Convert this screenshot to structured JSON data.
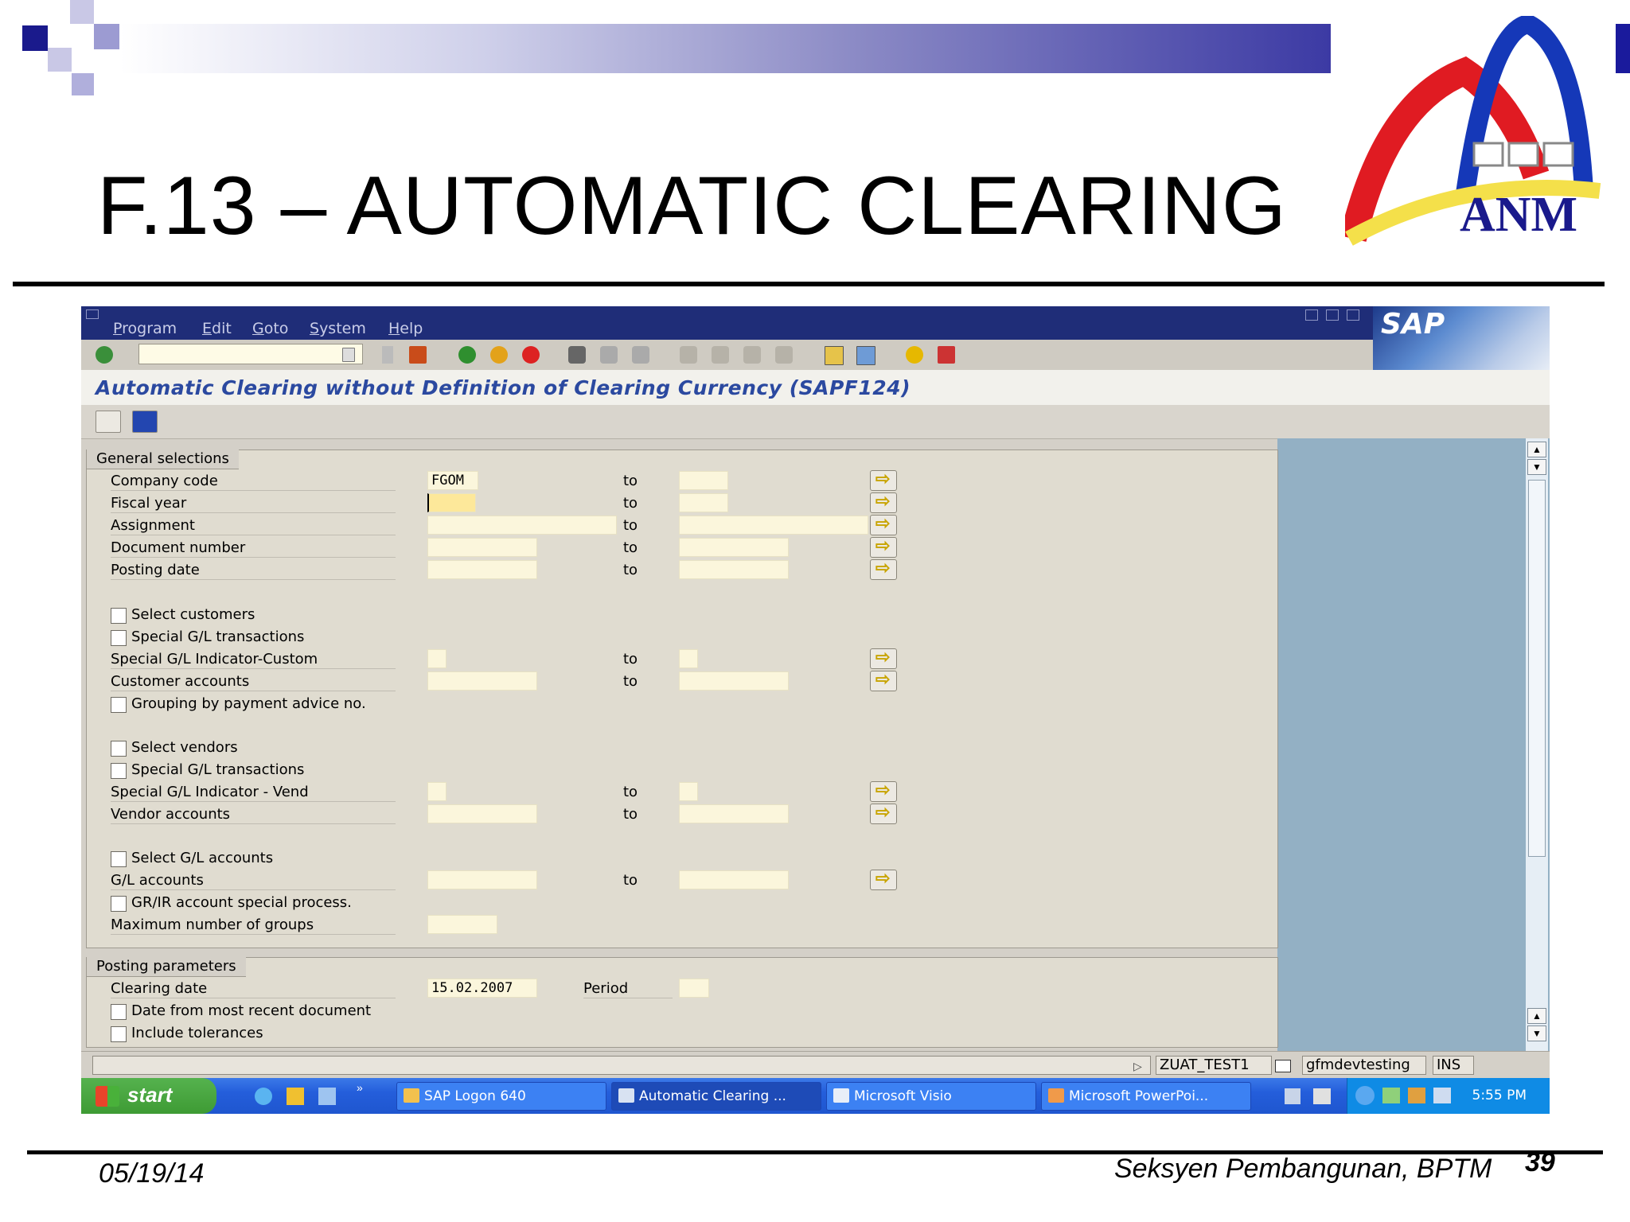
{
  "slide": {
    "title": "F.13 – AUTOMATIC CLEARING",
    "logo_text": "ANM",
    "footer_date": "05/19/14",
    "footer_org": "Seksyen Pembangunan, BPTM",
    "page_number": "39"
  },
  "sap": {
    "menu": [
      "Program",
      "Edit",
      "Goto",
      "System",
      "Help"
    ],
    "brand": "SAP",
    "screen_title": "Automatic Clearing without Definition of Clearing Currency (SAPF124)",
    "general": {
      "title": "General selections",
      "to": "to",
      "company_code": {
        "label": "Company code",
        "from": "FGOM",
        "to_value": ""
      },
      "fiscal_year": {
        "label": "Fiscal year",
        "from": "",
        "to_value": ""
      },
      "assignment": {
        "label": "Assignment"
      },
      "document_number": {
        "label": "Document number"
      },
      "posting_date": {
        "label": "Posting date"
      },
      "select_customers": "Select customers",
      "special_gl_cust": "Special G/L transactions",
      "special_gl_ind_cust": "Special G/L Indicator-Custom",
      "customer_accounts": "Customer accounts",
      "grouping": "Grouping by payment advice no.",
      "select_vendors": "Select vendors",
      "special_gl_vend": "Special G/L transactions",
      "special_gl_ind_vend": "Special G/L Indicator - Vend",
      "vendor_accounts": "Vendor accounts",
      "select_gl": "Select G/L accounts",
      "gl_accounts": "G/L accounts",
      "grir": "GR/IR account special process.",
      "max_groups": "Maximum number of groups"
    },
    "posting": {
      "title": "Posting parameters",
      "clearing_date_label": "Clearing date",
      "clearing_date": "15.02.2007",
      "period_label": "Period",
      "date_recent": "Date from most recent document",
      "include_tol": "Include tolerances"
    },
    "status": {
      "system": "ZUAT_TEST1",
      "server": "gfmdevtesting",
      "mode": "INS"
    }
  },
  "taskbar": {
    "start": "start",
    "items": [
      "SAP Logon 640",
      "Automatic Clearing ...",
      "Microsoft Visio",
      "Microsoft PowerPoi..."
    ],
    "clock": "5:55 PM"
  }
}
